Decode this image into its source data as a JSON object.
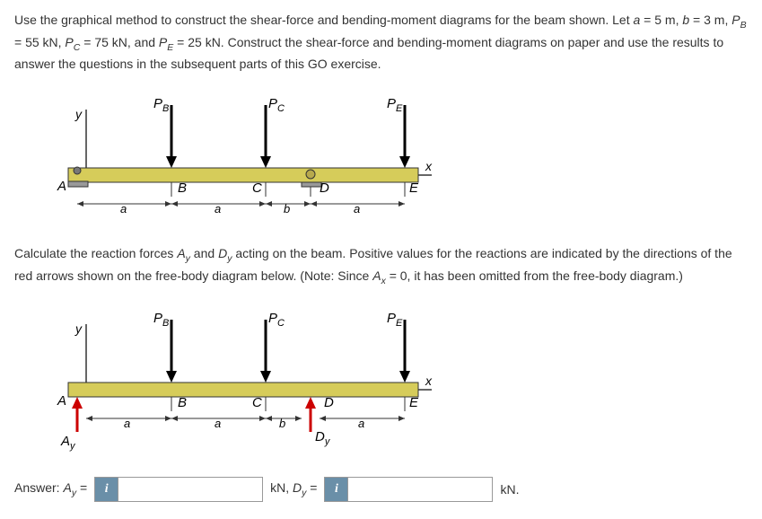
{
  "problem": {
    "line1_prefix": "Use the graphical method to construct the shear-force and bending-moment diagrams for the beam shown. Let ",
    "a_var": "a",
    "a_eq": " = 5 m, ",
    "b_var": "b",
    "b_eq": " = 3 m, ",
    "pb_var": "P",
    "pb_sub": "B",
    "pb_eq": " = 55 kN, ",
    "pc_var": "P",
    "pc_sub": "C",
    "pc_eq": " = 75 kN, and ",
    "pe_var": "P",
    "pe_sub": "E",
    "pe_eq": " = 25 kN. Construct the shear-force and bending-moment diagrams on paper and use the results to answer the questions in the subsequent parts of this GO exercise."
  },
  "calc": {
    "text_prefix": "Calculate the reaction forces ",
    "ay_var": "A",
    "ay_sub": "y",
    "and_text": " and ",
    "dy_var": "D",
    "dy_sub": "y",
    "text_mid": " acting on the beam. Positive values for the reactions are indicated by the directions of the red arrows shown on the free-body diagram below. (Note: Since ",
    "ax_var": "A",
    "ax_sub": "x",
    "text_end": " = 0, it has been omitted from the free-body diagram.)"
  },
  "diagram_labels": {
    "pb": "P",
    "pb_sub": "B",
    "pc": "P",
    "pc_sub": "C",
    "pe": "P",
    "pe_sub": "E",
    "y": "y",
    "x": "x",
    "A": "A",
    "B": "B",
    "C": "C",
    "D": "D",
    "E": "E",
    "a": "a",
    "b": "b",
    "Ay": "A",
    "Ay_sub": "y",
    "Dy": "D",
    "Dy_sub": "y"
  },
  "answer": {
    "prefix": "Answer: ",
    "ay_label_var": "A",
    "ay_label_sub": "y",
    "ay_eq": " = ",
    "info1": "i",
    "mid_unit": "kN, ",
    "dy_label_var": "D",
    "dy_label_sub": "y",
    "dy_eq": " = ",
    "info2": "i",
    "end_unit": "kN."
  }
}
